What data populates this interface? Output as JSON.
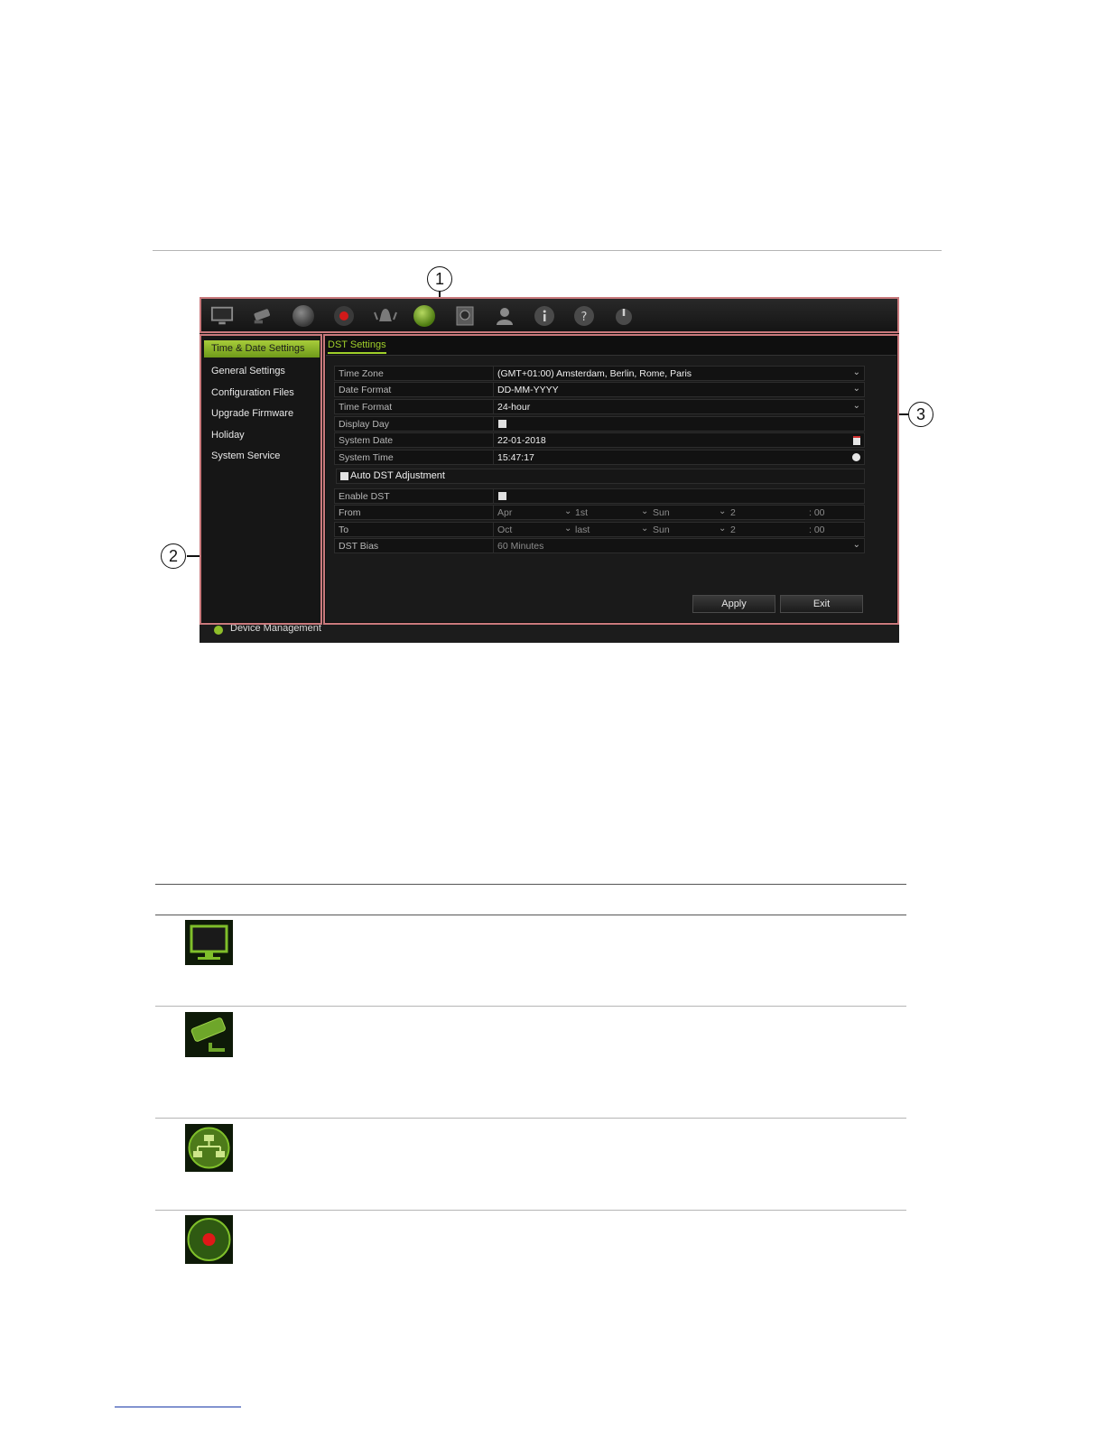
{
  "callouts": [
    "1",
    "2",
    "3"
  ],
  "toolbar": {
    "icons": [
      "monitor-icon",
      "camera-icon",
      "network-icon",
      "record-icon",
      "alarm-icon",
      "device-icon",
      "hdd-icon",
      "user-icon",
      "info-icon",
      "help-icon",
      "power-icon"
    ],
    "active_index": 5
  },
  "sidebar": {
    "items": [
      "Time & Date Settings",
      "General Settings",
      "Configuration Files",
      "Upgrade Firmware",
      "Holiday",
      "System Service"
    ],
    "active_index": 0
  },
  "panel": {
    "tab": "DST Settings",
    "fields": {
      "time_zone": {
        "label": "Time Zone",
        "value": "(GMT+01:00) Amsterdam, Berlin, Rome, Paris"
      },
      "date_format": {
        "label": "Date Format",
        "value": "DD-MM-YYYY"
      },
      "time_format": {
        "label": "Time Format",
        "value": "24-hour"
      },
      "display_day": {
        "label": "Display Day"
      },
      "system_date": {
        "label": "System Date",
        "value": "22-01-2018"
      },
      "system_time": {
        "label": "System Time",
        "value": "15:47:17"
      }
    },
    "auto_dst": "Auto DST Adjustment",
    "enable_dst": "Enable DST",
    "from": {
      "label": "From",
      "month": "Apr",
      "week": "1st",
      "day": "Sun",
      "hour": "2",
      "minute": ": 00"
    },
    "to": {
      "label": "To",
      "month": "Oct",
      "week": "last",
      "day": "Sun",
      "hour": "2",
      "minute": ": 00"
    },
    "dst_bias": {
      "label": "DST Bias",
      "value": "60 Minutes"
    },
    "apply": "Apply",
    "exit": "Exit"
  },
  "status": "Device Management",
  "colors": {
    "accent": "#9fcf2a",
    "callout_box": "#c9797c",
    "background": "#0d0d0d"
  }
}
